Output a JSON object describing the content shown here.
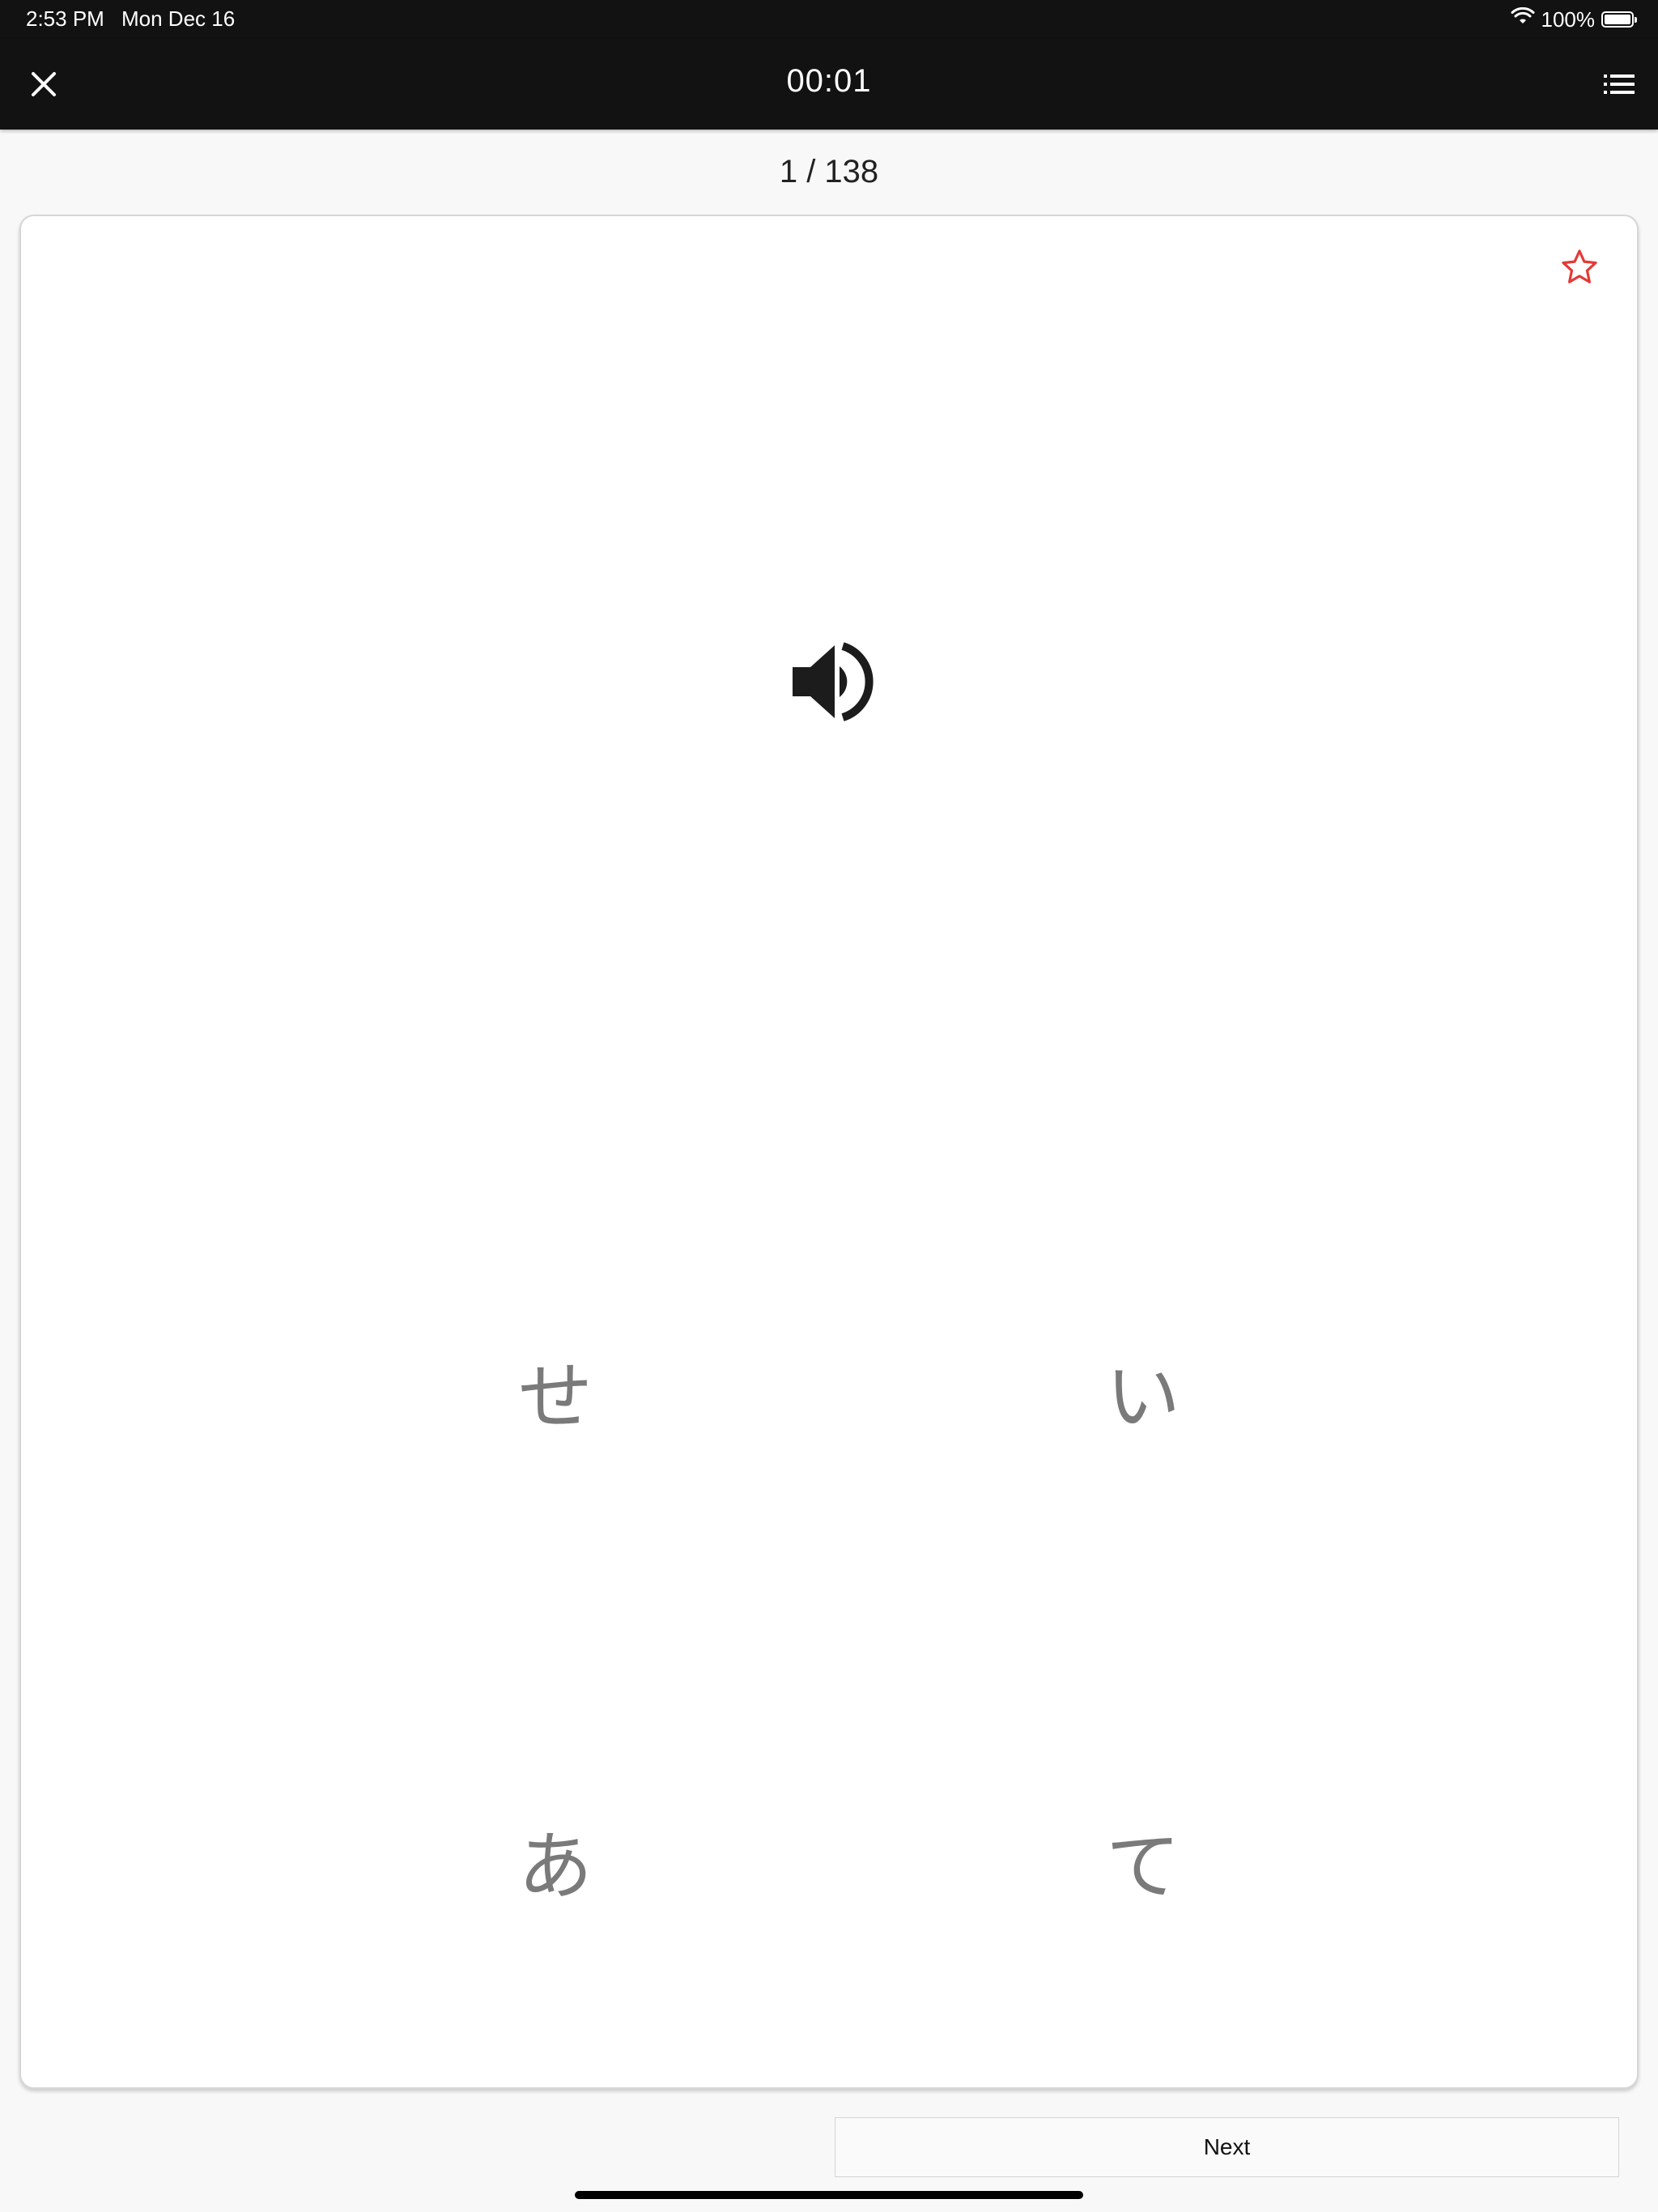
{
  "status_bar": {
    "time": "2:53 PM",
    "date": "Mon Dec 16",
    "battery": "100%",
    "battery_level": 1.0
  },
  "header": {
    "timer": "00:01",
    "close_icon": "close-icon",
    "menu_icon": "list-icon"
  },
  "progress": {
    "label": "1 / 138",
    "current": 1,
    "total": 138
  },
  "card": {
    "favorite_icon": "star-outline-icon",
    "favorite_color": "#e53935",
    "audio_icon": "speaker-icon",
    "choices": [
      "せ",
      "い",
      "あ",
      "て"
    ]
  },
  "footer": {
    "next_label": "Next"
  }
}
